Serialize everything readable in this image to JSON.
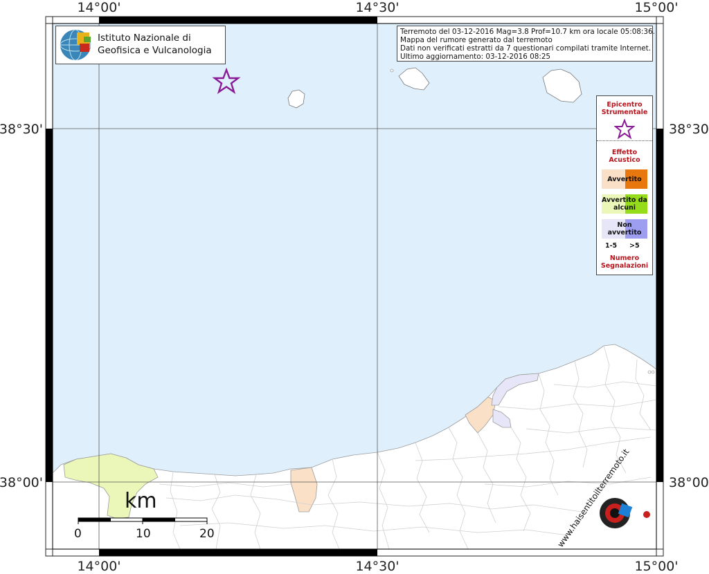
{
  "map": {
    "lon_labels": [
      "14°00'",
      "14°30'",
      "15°00'"
    ],
    "lat_labels": [
      "38°30'",
      "38°00'"
    ]
  },
  "institute": {
    "line1": "Istituto Nazionale di",
    "line2": "Geofisica e Vulcanologia"
  },
  "info": {
    "line1": "Terremoto del 03-12-2016 Mag=3.8 Prof=10.7 km ora locale 05:08:36.",
    "line2": "Mappa del rumore generato dal terremoto",
    "line3": "Dati non verificati estratti da 7 questionari compilati tramite Internet.",
    "line4": "Ultimo aggiornamento: 03-12-2016 08:25"
  },
  "legend": {
    "epicenter_title": "Epicentro Strumentale",
    "effect_title": "Effetto Acustico",
    "items": [
      {
        "label": "Avvertito",
        "color_low": "#fbe0c8",
        "color_high": "#e8770e"
      },
      {
        "label": "Avvertito da alcuni",
        "color_low": "#eaf7b8",
        "color_high": "#95dd1b"
      },
      {
        "label": "Non avvertito",
        "color_low": "#e6e6f8",
        "color_high": "#9e9ef0"
      }
    ],
    "count_low": "1-5",
    "count_high": ">5",
    "count_title": "Numero Segnalazioni",
    "epicenter_color": "#8b1a96"
  },
  "scale": {
    "unit": "km",
    "labels": [
      "0",
      "10",
      "20"
    ]
  },
  "logo": {
    "text": "www.haisentitoilterremoto.it"
  },
  "colors": {
    "sea": "#dff0fc",
    "land": "#ffffff",
    "border": "#cfcfcf"
  }
}
